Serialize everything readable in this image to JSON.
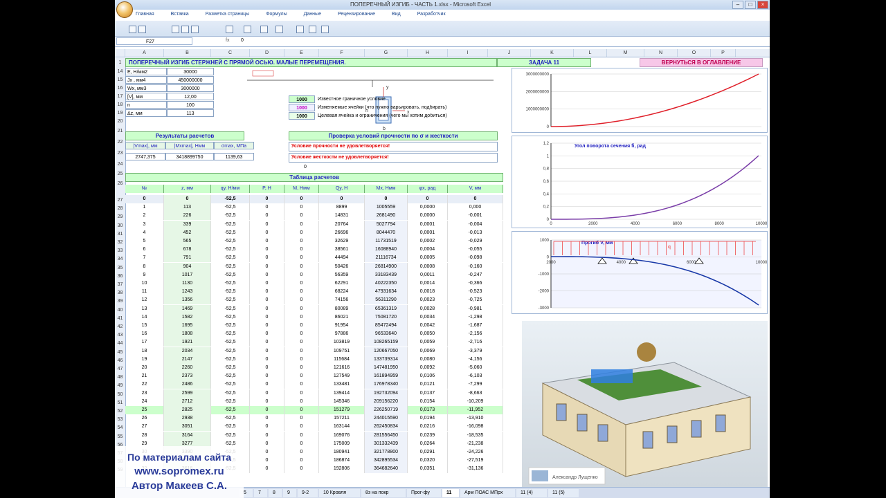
{
  "window": {
    "title": "ПОПЕРЕЧНЫЙ ИЗГИБ - ЧАСТЬ 1.xlsx - Microsoft Excel"
  },
  "ribbon_tabs": [
    "Главная",
    "Вставка",
    "Разметка страницы",
    "Формулы",
    "Данные",
    "Рецензирование",
    "Вид",
    "Разработчик"
  ],
  "formula_bar": {
    "cell_ref": "F27",
    "value": "0"
  },
  "columns": [
    "A",
    "B",
    "C",
    "D",
    "E",
    "F",
    "G",
    "H",
    "I",
    "J",
    "K",
    "L",
    "M",
    "N",
    "O",
    "P"
  ],
  "header": {
    "main_title": "ПОПЕРЕЧНЫЙ ИЗГИБ СТЕРЖНЕЙ С ПРЯМОЙ ОСЬЮ. МАЛЫЕ ПЕРЕМЕЩЕНИЯ.",
    "task": "ЗАДАЧА 11",
    "return_link": "ВЕРНУТЬСЯ В ОГЛАВЛЕНИЕ"
  },
  "params": [
    {
      "row": "14",
      "label": "E, Н/мм2",
      "value": "30000"
    },
    {
      "row": "15",
      "label": "Jx , мм4",
      "value": "450000000"
    },
    {
      "row": "16",
      "label": "Wx, мм3",
      "value": "3000000"
    },
    {
      "row": "17",
      "label": "[V], мм",
      "value": "12,00"
    },
    {
      "row": "18",
      "label": "n",
      "value": "100"
    },
    {
      "row": "19",
      "label": "Δz, мм",
      "value": "113"
    }
  ],
  "legend": [
    {
      "value": "1000",
      "text": "Известное граничное условие"
    },
    {
      "value": "1000",
      "text": "Изменяемые ячейки (что нужно варьировать, подбирать)"
    },
    {
      "value": "1000",
      "text": "Целевая ячейка и ограничения (чего мы хотим добиться)"
    }
  ],
  "results": {
    "title": "Результаты расчетов",
    "headers": [
      "|Vmax|, мм",
      "|Mxmax|, Нмм",
      "σmax, МПа"
    ],
    "values": [
      "2747,375",
      "3418899750",
      "1139,63"
    ],
    "extra": "0"
  },
  "checks": {
    "title": "Проверка условий прочности по σ и жесткости",
    "strength": "Условие прочности не удовлетворяется!",
    "rigidity": "Условие жесткости не удовлетворяется!"
  },
  "table": {
    "title": "Таблица расчетов",
    "headers": [
      "№",
      "z, мм",
      "qy, Н/мм",
      "P, Н",
      "M, Нмм",
      "Qy, Н",
      "Mx, Нмм",
      "φx, рад",
      "V, мм"
    ],
    "rows": [
      [
        "0",
        "0",
        "-52,5",
        "0",
        "0",
        "0",
        "0",
        "0",
        "0"
      ],
      [
        "1",
        "113",
        "-52,5",
        "0",
        "0",
        "8899",
        "1005559",
        "0,0000",
        "0,000"
      ],
      [
        "2",
        "226",
        "-52,5",
        "0",
        "0",
        "14831",
        "2681490",
        "0,0000",
        "-0,001"
      ],
      [
        "3",
        "339",
        "-52,5",
        "0",
        "0",
        "20764",
        "5027794",
        "0,0001",
        "-0,004"
      ],
      [
        "4",
        "452",
        "-52,5",
        "0",
        "0",
        "26696",
        "8044470",
        "0,0001",
        "-0,013"
      ],
      [
        "5",
        "565",
        "-52,5",
        "0",
        "0",
        "32629",
        "11731519",
        "0,0002",
        "-0,029"
      ],
      [
        "6",
        "678",
        "-52,5",
        "0",
        "0",
        "38561",
        "16088940",
        "0,0004",
        "-0,055"
      ],
      [
        "7",
        "791",
        "-52,5",
        "0",
        "0",
        "44494",
        "21116734",
        "0,0005",
        "-0,098"
      ],
      [
        "8",
        "904",
        "-52,5",
        "0",
        "0",
        "50426",
        "26814900",
        "0,0008",
        "-0,160"
      ],
      [
        "9",
        "1017",
        "-52,5",
        "0",
        "0",
        "56359",
        "33183439",
        "0,0011",
        "-0,247"
      ],
      [
        "10",
        "1130",
        "-52,5",
        "0",
        "0",
        "62291",
        "40222350",
        "0,0014",
        "-0,366"
      ],
      [
        "11",
        "1243",
        "-52,5",
        "0",
        "0",
        "68224",
        "47931634",
        "0,0018",
        "-0,523"
      ],
      [
        "12",
        "1356",
        "-52,5",
        "0",
        "0",
        "74156",
        "56311290",
        "0,0023",
        "-0,725"
      ],
      [
        "13",
        "1469",
        "-52,5",
        "0",
        "0",
        "80089",
        "65361319",
        "0,0028",
        "-0,981"
      ],
      [
        "14",
        "1582",
        "-52,5",
        "0",
        "0",
        "86021",
        "75081720",
        "0,0034",
        "-1,298"
      ],
      [
        "15",
        "1695",
        "-52,5",
        "0",
        "0",
        "91954",
        "85472494",
        "0,0042",
        "-1,687"
      ],
      [
        "16",
        "1808",
        "-52,5",
        "0",
        "0",
        "97886",
        "96533640",
        "0,0050",
        "-2,156"
      ],
      [
        "17",
        "1921",
        "-52,5",
        "0",
        "0",
        "103819",
        "108265159",
        "0,0059",
        "-2,716"
      ],
      [
        "18",
        "2034",
        "-52,5",
        "0",
        "0",
        "109751",
        "120667050",
        "0,0069",
        "-3,379"
      ],
      [
        "19",
        "2147",
        "-52,5",
        "0",
        "0",
        "115684",
        "133739314",
        "0,0080",
        "-4,156"
      ],
      [
        "20",
        "2260",
        "-52,5",
        "0",
        "0",
        "121616",
        "147481950",
        "0,0092",
        "-5,060"
      ],
      [
        "21",
        "2373",
        "-52,5",
        "0",
        "0",
        "127549",
        "161894959",
        "0,0106",
        "-6,103"
      ],
      [
        "22",
        "2486",
        "-52,5",
        "0",
        "0",
        "133481",
        "176978340",
        "0,0121",
        "-7,299"
      ],
      [
        "23",
        "2599",
        "-52,5",
        "0",
        "0",
        "139414",
        "192732094",
        "0,0137",
        "-8,663"
      ],
      [
        "24",
        "2712",
        "-52,5",
        "0",
        "0",
        "145346",
        "209156220",
        "0,0154",
        "-10,209"
      ],
      [
        "25",
        "2825",
        "-52,5",
        "0",
        "0",
        "151279",
        "226250719",
        "0,0173",
        "-11,952"
      ],
      [
        "26",
        "2938",
        "-52,5",
        "0",
        "0",
        "157211",
        "244015590",
        "0,0194",
        "-13,910"
      ],
      [
        "27",
        "3051",
        "-52,5",
        "0",
        "0",
        "163144",
        "262450834",
        "0,0216",
        "-16,098"
      ],
      [
        "28",
        "3164",
        "-52,5",
        "0",
        "0",
        "169076",
        "281556450",
        "0,0239",
        "-18,535"
      ],
      [
        "29",
        "3277",
        "-52,5",
        "0",
        "0",
        "175009",
        "301332439",
        "0,0264",
        "-21,238"
      ],
      [
        "30",
        "3390",
        "-52,5",
        "0",
        "0",
        "180941",
        "321778800",
        "0,0291",
        "-24,226"
      ],
      [
        "31",
        "3503",
        "-52,5",
        "0",
        "0",
        "186874",
        "342895534",
        "0,0320",
        "-27,519"
      ],
      [
        "32",
        "3616",
        "-52,5",
        "0",
        "0",
        "192806",
        "364682640",
        "0,0351",
        "-31,136"
      ]
    ],
    "row_numbers": [
      "27",
      "28",
      "29",
      "30",
      "31",
      "32",
      "33",
      "34",
      "35",
      "36",
      "37",
      "38",
      "39",
      "40",
      "41",
      "42",
      "43",
      "44",
      "45",
      "46",
      "47",
      "48",
      "49",
      "50",
      "51",
      "52",
      "53",
      "54",
      "55",
      "56",
      "57",
      "58",
      "59"
    ]
  },
  "charts": [
    {
      "title": "",
      "yticks": [
        "3000000000",
        "2000000000",
        "1000000000",
        "0"
      ]
    },
    {
      "title": "Угол поворота сечения fi, рад",
      "yticks": [
        "1,2",
        "1",
        "0,8",
        "0,6",
        "0,4",
        "0,2",
        "0"
      ],
      "xticks": [
        "0",
        "2000",
        "4000",
        "6000",
        "8000",
        "10000"
      ]
    },
    {
      "title": "Прогиб V, мм",
      "yticks": [
        "1000",
        "0",
        "-1000",
        "-2000",
        "-3000"
      ],
      "xticks": [
        "2000",
        "4000",
        "6000",
        "10000"
      ],
      "q_label": "q"
    }
  ],
  "sheet_tabs": [
    "5",
    "7",
    "8",
    "9",
    "9-2",
    "10 Кровля",
    "8з на покр",
    "Прог-фу",
    "11",
    "Арм ПОАС МПрх",
    "11 (4)",
    "11 (5)"
  ],
  "watermark": {
    "line1": "По материалам сайта",
    "line2": "www.sopromex.ru",
    "line3": "Автор Макеев С.А."
  },
  "photo_caption": "Александр Лущенко",
  "colors": {
    "green_cell": "#ccffcc",
    "title_blue": "#1f1fbf",
    "red_text": "#e00000",
    "pink_button": "#f7c7e8"
  }
}
